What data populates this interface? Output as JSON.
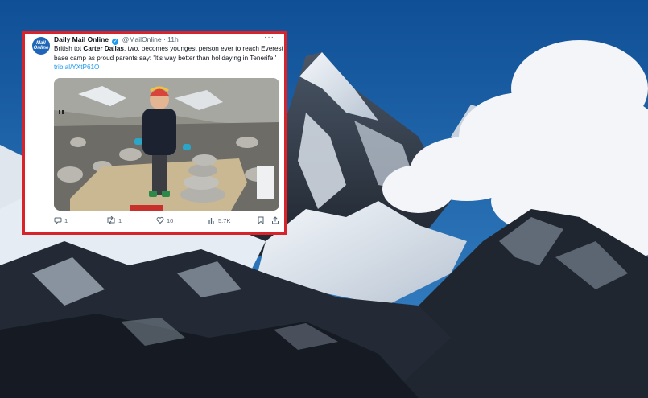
{
  "tweet": {
    "account_name": "Daily Mail Online",
    "handle": "@MailOnline",
    "separator": "·",
    "time": "11h",
    "more": "···",
    "avatar_line1": "Mail",
    "avatar_line2": "Online",
    "text_before": "British tot ",
    "text_bold": "Carter Dallas",
    "text_after": ", two, becomes youngest person ever to reach Everest base camp as proud parents say: 'It's way better than holidaying in Tenerife!' ",
    "link": "trib.al/YXtP61O",
    "reply_count": "1",
    "retweet_count": "1",
    "like_count": "10",
    "view_count": "5.7K"
  },
  "colors": {
    "frame": "#d8232a",
    "sky": "#1a5a9c",
    "verified": "#1d9bf0",
    "link": "#1d9bf0"
  },
  "icons": [
    "verified-badge-icon",
    "more-options-icon",
    "reply-icon",
    "retweet-icon",
    "like-icon",
    "views-icon",
    "bookmark-icon",
    "share-icon"
  ]
}
